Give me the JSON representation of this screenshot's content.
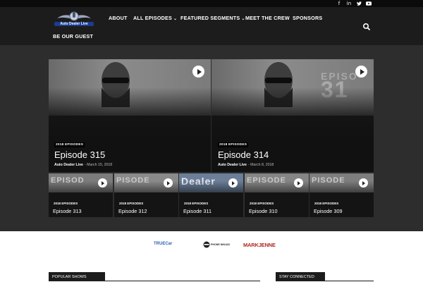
{
  "social": [
    "f",
    "in",
    "t",
    "yt"
  ],
  "brand": {
    "logo_text": "Auto Dealer Live"
  },
  "nav": [
    {
      "label": "ABOUT",
      "dropdown": false
    },
    {
      "label": "ALL EPISODES",
      "dropdown": true
    },
    {
      "label": "FEATURED SEGMENTS",
      "dropdown": true
    },
    {
      "label": "MEET THE CREW",
      "dropdown": false
    },
    {
      "label": "SPONSORS",
      "dropdown": false
    },
    {
      "label": "BE OUR GUEST",
      "dropdown": false
    }
  ],
  "featured": [
    {
      "category": "2018 EPISODES",
      "title": "Episode 315",
      "author": "Auto Dealer Live",
      "date": "March 15, 2018",
      "overlay": ""
    },
    {
      "category": "2018 EPISODES",
      "title": "Episode 314",
      "author": "Auto Dealer Live",
      "date": "March 8, 2018",
      "overlay": "EPISO 31"
    }
  ],
  "episodes": [
    {
      "category": "2018 EPISODES",
      "title": "Episode 313",
      "overlay": "EPISOD 313"
    },
    {
      "category": "2018 EPISODES",
      "title": "Episode 312",
      "overlay": "PISODE 312"
    },
    {
      "category": "2018 EPISODES",
      "title": "Episode 311",
      "overlay": "Dealer"
    },
    {
      "category": "2018 EPISODES",
      "title": "Episode 310",
      "overlay": "EPISODE 310"
    },
    {
      "category": "2018 EPISODES",
      "title": "Episode 309",
      "overlay": "PISODE 309"
    }
  ],
  "sponsors": [
    {
      "label": "TRUECar",
      "color": "#2b5fb3"
    },
    {
      "label": "PHONE NINJAS",
      "color": "#222222"
    },
    {
      "label": "MARKJENNE",
      "color": "#b3261e"
    }
  ],
  "footer": {
    "popular_shows": "POPULAR SHOWS",
    "stay_connected": "STAY CONNECTED"
  },
  "colors": {
    "header": "#1c1c1c",
    "band": "#2d2d2d",
    "accent": "#1a3d8f"
  }
}
